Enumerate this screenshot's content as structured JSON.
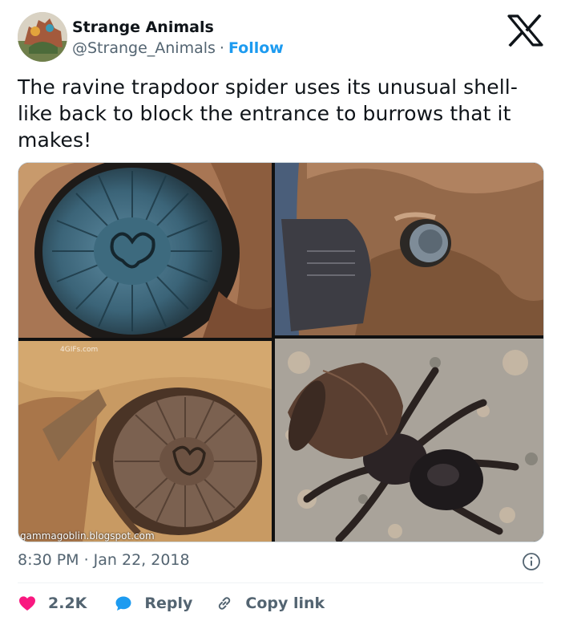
{
  "author": {
    "display_name": "Strange Animals",
    "handle": "@Strange_Animals",
    "separator": "·",
    "follow_label": "Follow"
  },
  "tweet": {
    "text": "The ravine trapdoor spider uses its unusual shell-like back to block the entrance to burrows that it makes!",
    "timestamp": "8:30 PM · Jan 22, 2018"
  },
  "media": {
    "watermark_small": "4GIFs.com",
    "watermark_source": "gammagoblin.blogspot.com"
  },
  "actions": {
    "like_count": "2.2K",
    "reply_label": "Reply",
    "copy_link_label": "Copy link"
  },
  "colors": {
    "accent": "#1d9bf0",
    "like": "#f91880",
    "secondary_text": "#536471"
  }
}
